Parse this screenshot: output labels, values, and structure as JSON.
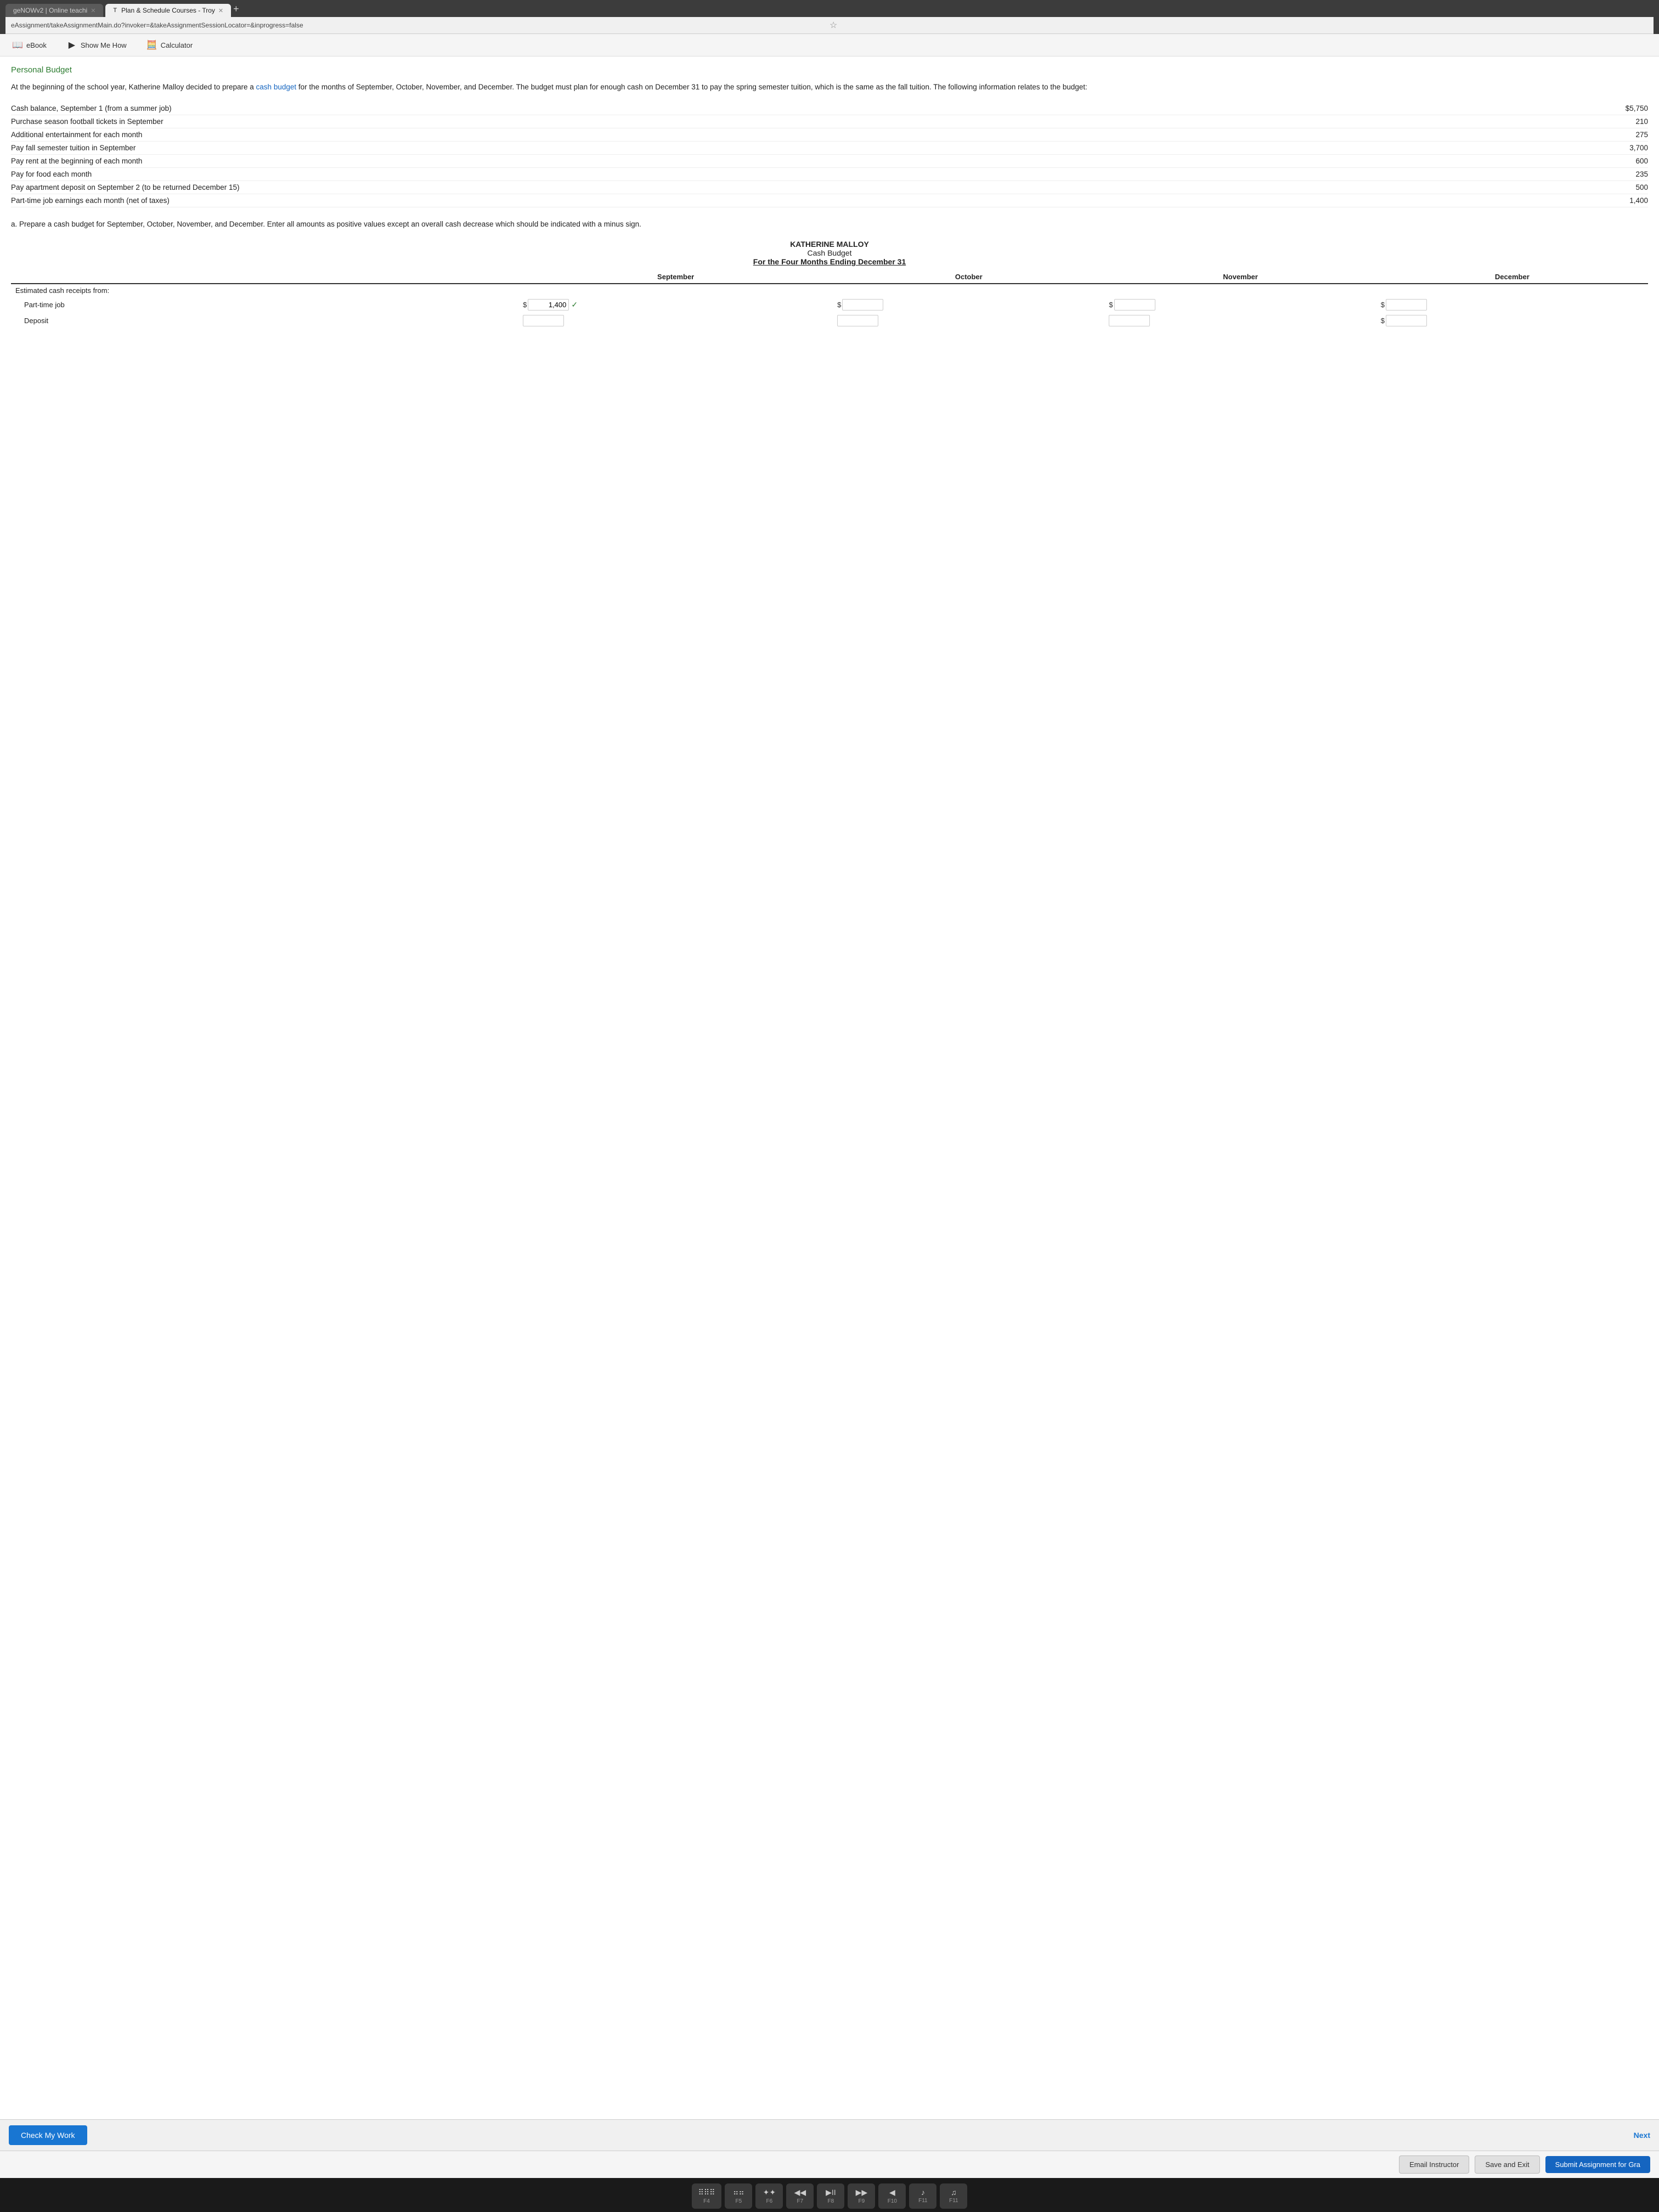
{
  "browser": {
    "tabs": [
      {
        "id": "tab1",
        "label": "geNOWv2 | Online teachi",
        "active": false
      },
      {
        "id": "tab2",
        "label": "Plan & Schedule Courses - Troy",
        "active": true
      }
    ],
    "tab_plus": "+",
    "address_bar": "eAssignment/takeAssignmentMain.do?invoker=&takeAssignmentSessionLocator=&inprogress=false"
  },
  "toolbar": {
    "ebook_label": "eBook",
    "show_me_how_label": "Show Me How",
    "calculator_label": "Calculator"
  },
  "page": {
    "section_title": "Personal Budget",
    "intro": "At the beginning of the school year, Katherine Malloy decided to prepare a cash budget for the months of September, October, November, and December. The budget must plan for enough cash on December 31 to pay the spring semester tuition, which is the same as the fall tuition. The following information relates to the budget:",
    "highlight_text": "cash budget",
    "budget_items": [
      {
        "label": "Cash balance, September 1 (from a summer job)",
        "value": "$5,750"
      },
      {
        "label": "Purchase season football tickets in September",
        "value": "210"
      },
      {
        "label": "Additional entertainment for each month",
        "value": "275"
      },
      {
        "label": "Pay fall semester tuition in September",
        "value": "3,700"
      },
      {
        "label": "Pay rent at the beginning of each month",
        "value": "600"
      },
      {
        "label": "Pay for food each month",
        "value": "235"
      },
      {
        "label": "Pay apartment deposit on September 2 (to be returned December 15)",
        "value": "500"
      },
      {
        "label": "Part-time job earnings each month (net of taxes)",
        "value": "1,400"
      }
    ],
    "instructions": "a.  Prepare a cash budget for September, October, November, and December. Enter all amounts as positive values except an overall cash decrease which should be indicated with a minus sign.",
    "table_header": {
      "company": "KATHERINE MALLOY",
      "title": "Cash Budget",
      "subtitle": "For the Four Months Ending December 31"
    },
    "table_columns": [
      "September",
      "October",
      "November",
      "December"
    ],
    "table_rows": [
      {
        "type": "section",
        "label": "Estimated cash receipts from:"
      },
      {
        "type": "input_row",
        "label": "Part-time job",
        "indent": true,
        "values": [
          "1,400",
          "",
          "",
          ""
        ],
        "show_dollar": [
          true,
          true,
          true,
          true
        ],
        "checked": [
          true,
          false,
          false,
          false
        ]
      },
      {
        "type": "input_row",
        "label": "Deposit",
        "indent": true,
        "values": [
          "",
          "",
          "",
          ""
        ],
        "show_dollar": [
          false,
          false,
          false,
          true
        ],
        "checked": [
          false,
          false,
          false,
          false
        ]
      }
    ]
  },
  "footer": {
    "check_my_work": "Check My Work",
    "next": "Next"
  },
  "action_bar": {
    "email_instructor": "Email Instructor",
    "save_and_exit": "Save and Exit",
    "submit_assignment": "Submit Assignment for Gra"
  },
  "keyboard": {
    "keys": [
      {
        "icon": "⠿",
        "label": "F4"
      },
      {
        "icon": "⠿",
        "label": "F5"
      },
      {
        "icon": "✦",
        "label": "F6"
      },
      {
        "icon": "◀◀",
        "label": "F7"
      },
      {
        "icon": "▶II",
        "label": "F8"
      },
      {
        "icon": "▶▶",
        "label": "F9"
      },
      {
        "icon": "◀",
        "label": "F10"
      },
      {
        "icon": "♪",
        "label": "F11"
      },
      {
        "icon": "♫",
        "label": "F11"
      }
    ]
  }
}
